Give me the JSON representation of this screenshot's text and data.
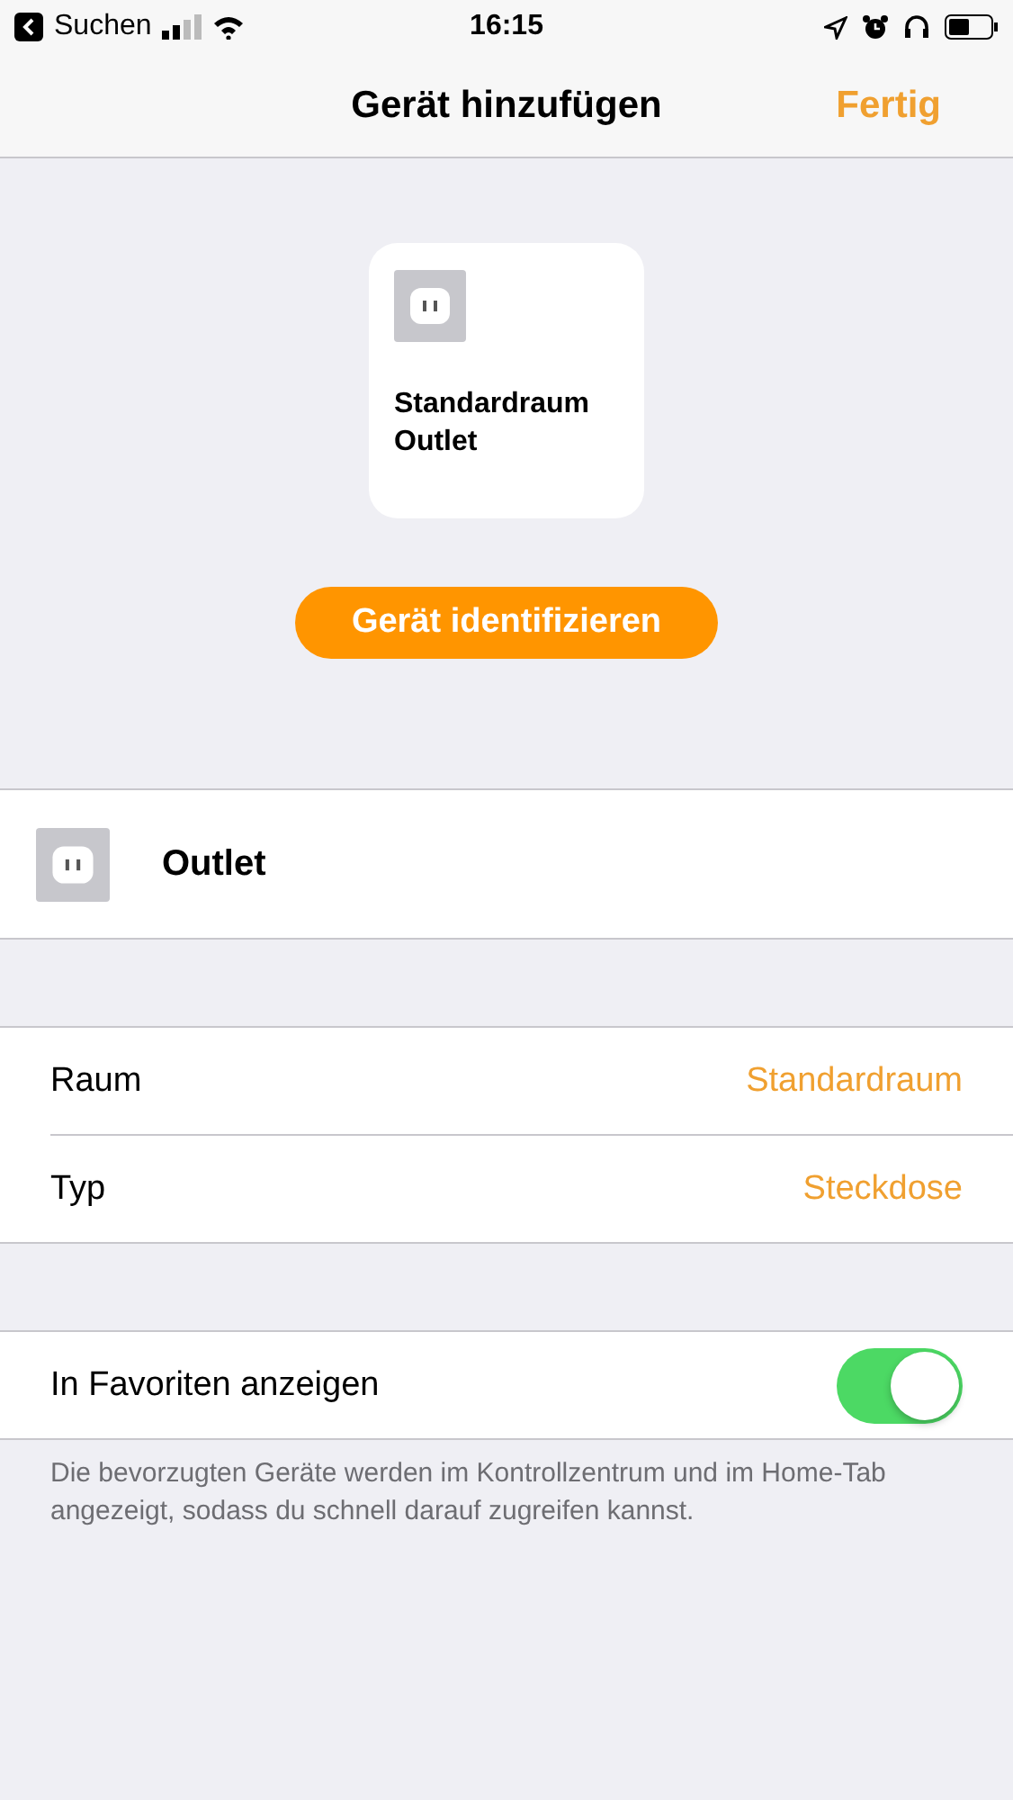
{
  "status_bar": {
    "back_label": "Suchen",
    "time": "16:15"
  },
  "nav": {
    "title": "Gerät hinzufügen",
    "done": "Fertig"
  },
  "tile": {
    "room": "Standardraum",
    "name": "Outlet"
  },
  "identify_button": "Gerät identifizieren",
  "accessory_name": "Outlet",
  "settings": [
    {
      "label": "Raum",
      "value": "Standardraum"
    },
    {
      "label": "Typ",
      "value": "Steckdose"
    }
  ],
  "favorite": {
    "label": "In Favoriten anzeigen",
    "on": true
  },
  "footer_note": "Die bevorzugten Geräte werden im Kontrollzentrum und im Home-Tab angezeigt, sodass du schnell darauf zugreifen kannst."
}
